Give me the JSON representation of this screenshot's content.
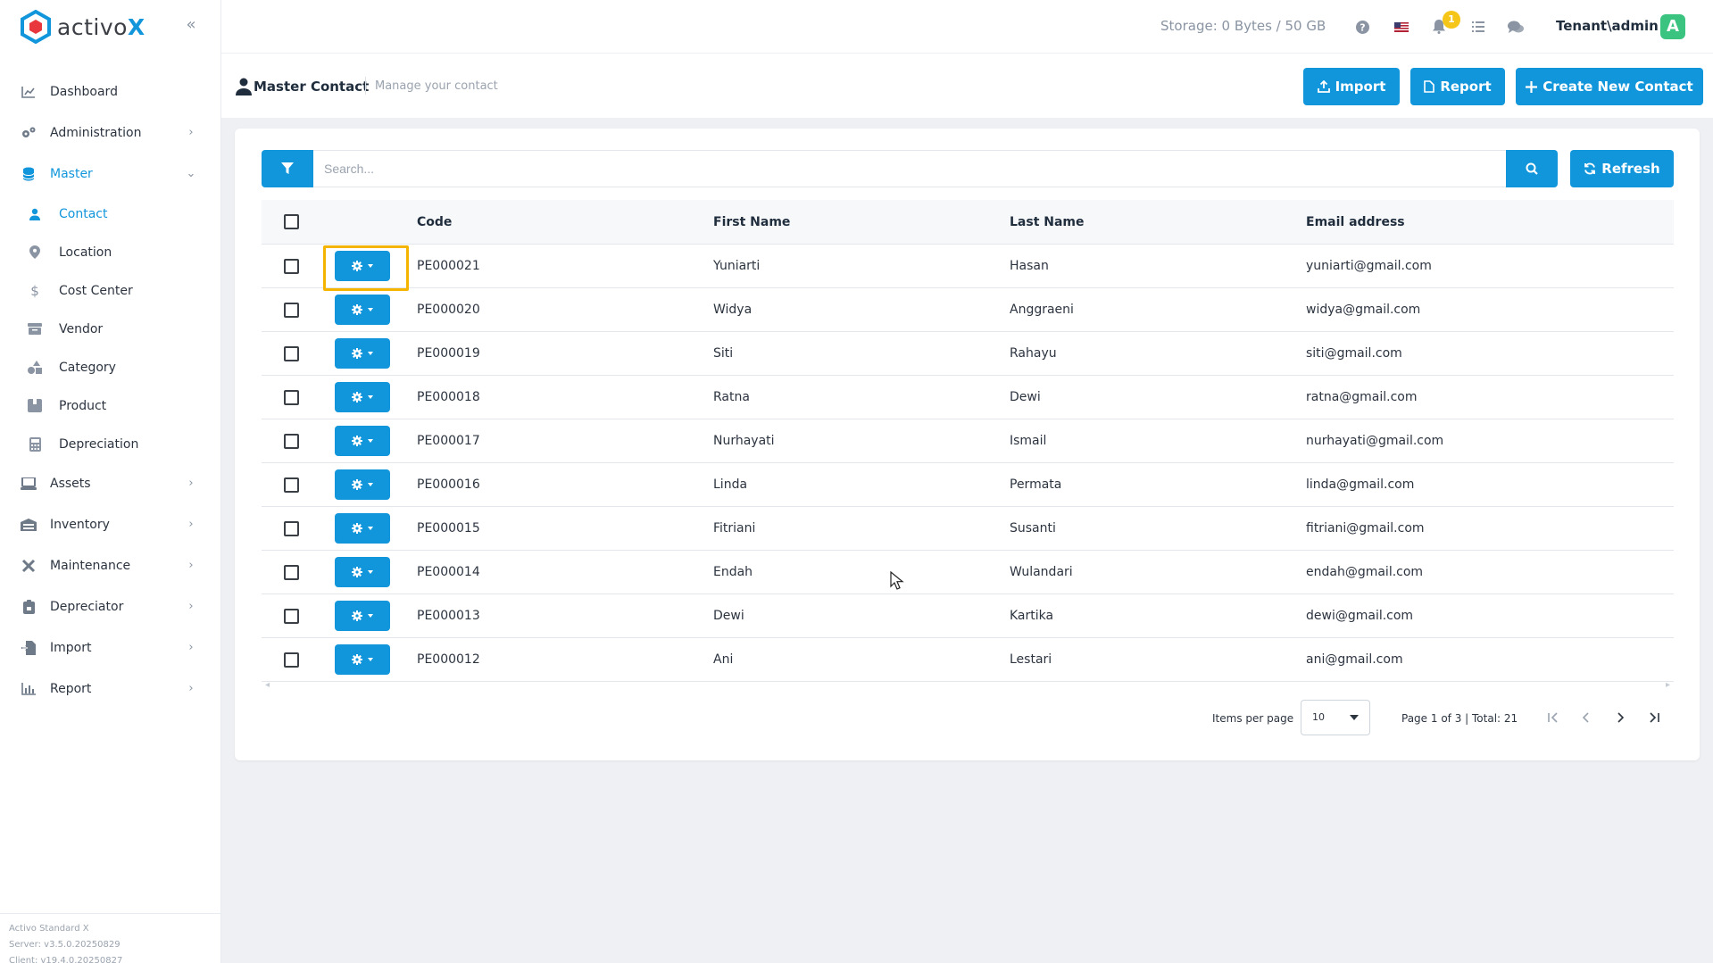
{
  "app": {
    "logo_prefix": "activo",
    "logo_suffix": "X",
    "brand_color": "#1296db"
  },
  "sidebar": {
    "items": [
      {
        "label": "Dashboard",
        "icon": "chart-line-icon",
        "has_children": false
      },
      {
        "label": "Administration",
        "icon": "gears-icon",
        "has_children": true
      },
      {
        "label": "Master",
        "icon": "database-icon",
        "has_children": true,
        "expanded": true
      },
      {
        "label": "Assets",
        "icon": "laptop-icon",
        "has_children": true
      },
      {
        "label": "Inventory",
        "icon": "warehouse-icon",
        "has_children": true
      },
      {
        "label": "Maintenance",
        "icon": "tools-icon",
        "has_children": true
      },
      {
        "label": "Depreciator",
        "icon": "clipboard-icon",
        "has_children": true
      },
      {
        "label": "Import",
        "icon": "file-import-icon",
        "has_children": true
      },
      {
        "label": "Report",
        "icon": "bar-chart-icon",
        "has_children": true
      }
    ],
    "master_children": [
      {
        "label": "Contact",
        "icon": "user-icon",
        "active": true
      },
      {
        "label": "Location",
        "icon": "map-pin-icon"
      },
      {
        "label": "Cost Center",
        "icon": "dollar-icon"
      },
      {
        "label": "Vendor",
        "icon": "box-icon"
      },
      {
        "label": "Category",
        "icon": "shapes-icon"
      },
      {
        "label": "Product",
        "icon": "package-icon"
      },
      {
        "label": "Depreciation",
        "icon": "calculator-icon"
      }
    ],
    "footer": {
      "product": "Activo Standard X",
      "server": "Server: v3.5.0.20250829",
      "client": "Client: v19.4.0.20250827"
    }
  },
  "topbar": {
    "storage": "Storage: 0 Bytes / 50 GB",
    "notification_count": "1",
    "user": "Tenant\\admin",
    "avatar_letter": "A"
  },
  "page_header": {
    "title": "Master Contact",
    "subtitle": "Manage your contact",
    "buttons": {
      "import": "Import",
      "report": "Report",
      "create": "Create New Contact"
    }
  },
  "search": {
    "placeholder": "Search...",
    "value": "",
    "refresh_label": "Refresh"
  },
  "table": {
    "columns": [
      "Code",
      "First Name",
      "Last Name",
      "Email address"
    ],
    "rows": [
      {
        "code": "PE000021",
        "first": "Yuniarti",
        "last": "Hasan",
        "email": "yuniarti@gmail.com"
      },
      {
        "code": "PE000020",
        "first": "Widya",
        "last": "Anggraeni",
        "email": "widya@gmail.com"
      },
      {
        "code": "PE000019",
        "first": "Siti",
        "last": "Rahayu",
        "email": "siti@gmail.com"
      },
      {
        "code": "PE000018",
        "first": "Ratna",
        "last": "Dewi",
        "email": "ratna@gmail.com"
      },
      {
        "code": "PE000017",
        "first": "Nurhayati",
        "last": "Ismail",
        "email": "nurhayati@gmail.com"
      },
      {
        "code": "PE000016",
        "first": "Linda",
        "last": "Permata",
        "email": "linda@gmail.com"
      },
      {
        "code": "PE000015",
        "first": "Fitriani",
        "last": "Susanti",
        "email": "fitriani@gmail.com"
      },
      {
        "code": "PE000014",
        "first": "Endah",
        "last": "Wulandari",
        "email": "endah@gmail.com"
      },
      {
        "code": "PE000013",
        "first": "Dewi",
        "last": "Kartika",
        "email": "dewi@gmail.com"
      },
      {
        "code": "PE000012",
        "first": "Ani",
        "last": "Lestari",
        "email": "ani@gmail.com"
      }
    ]
  },
  "pagination": {
    "items_per_page_label": "Items per page",
    "items_per_page": "10",
    "info": "Page 1 of 3 | Total: 21"
  }
}
